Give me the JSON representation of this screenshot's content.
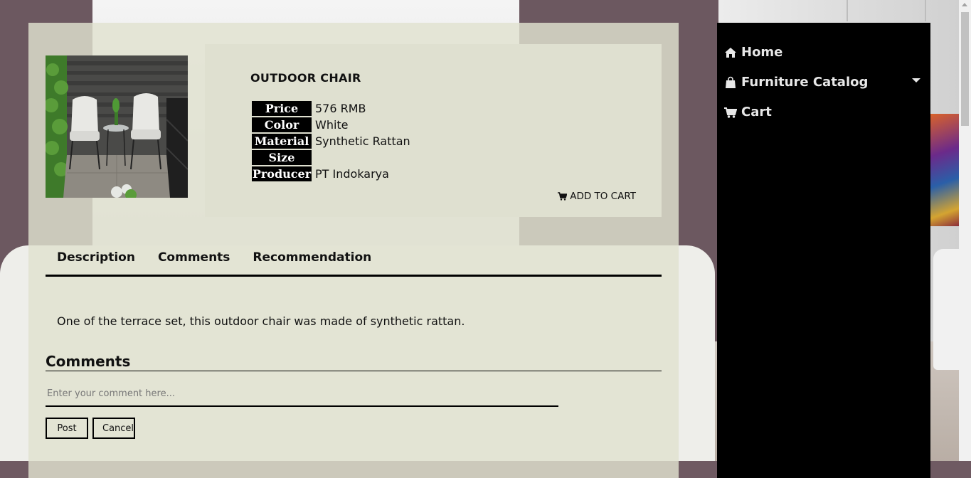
{
  "product": {
    "title": "OUTDOOR CHAIR",
    "image_alt": "outdoor-chair-photo",
    "specs": [
      {
        "label": "Price",
        "value": "576 RMB"
      },
      {
        "label": "Color",
        "value": "White"
      },
      {
        "label": "Material",
        "value": "Synthetic Rattan"
      },
      {
        "label": "Size",
        "value": ""
      },
      {
        "label": "Producer",
        "value": "PT Indokarya"
      }
    ],
    "add_to_cart_label": "ADD TO CART",
    "add_to_cart_icon": "cart-icon"
  },
  "tabs": [
    {
      "label": "Description"
    },
    {
      "label": "Comments"
    },
    {
      "label": "Recommendation"
    }
  ],
  "description_text": "One of the terrace set, this outdoor chair was made of synthetic rattan.",
  "comments": {
    "heading": "Comments",
    "placeholder": "Enter your comment here...",
    "post_label": "Post",
    "cancel_label": "Cancel"
  },
  "sidebar": {
    "items": [
      {
        "label": "Home",
        "icon": "home-icon"
      },
      {
        "label": "Furniture Catalog",
        "icon": "shopping-bag-icon",
        "has_dropdown": true
      },
      {
        "label": "Cart",
        "icon": "cart-icon"
      }
    ]
  },
  "colors": {
    "sidebar_bg": "#000000",
    "panel_bg": "#e0e2d0",
    "spec_label_bg": "#000000",
    "spec_label_text": "#ffffff"
  }
}
